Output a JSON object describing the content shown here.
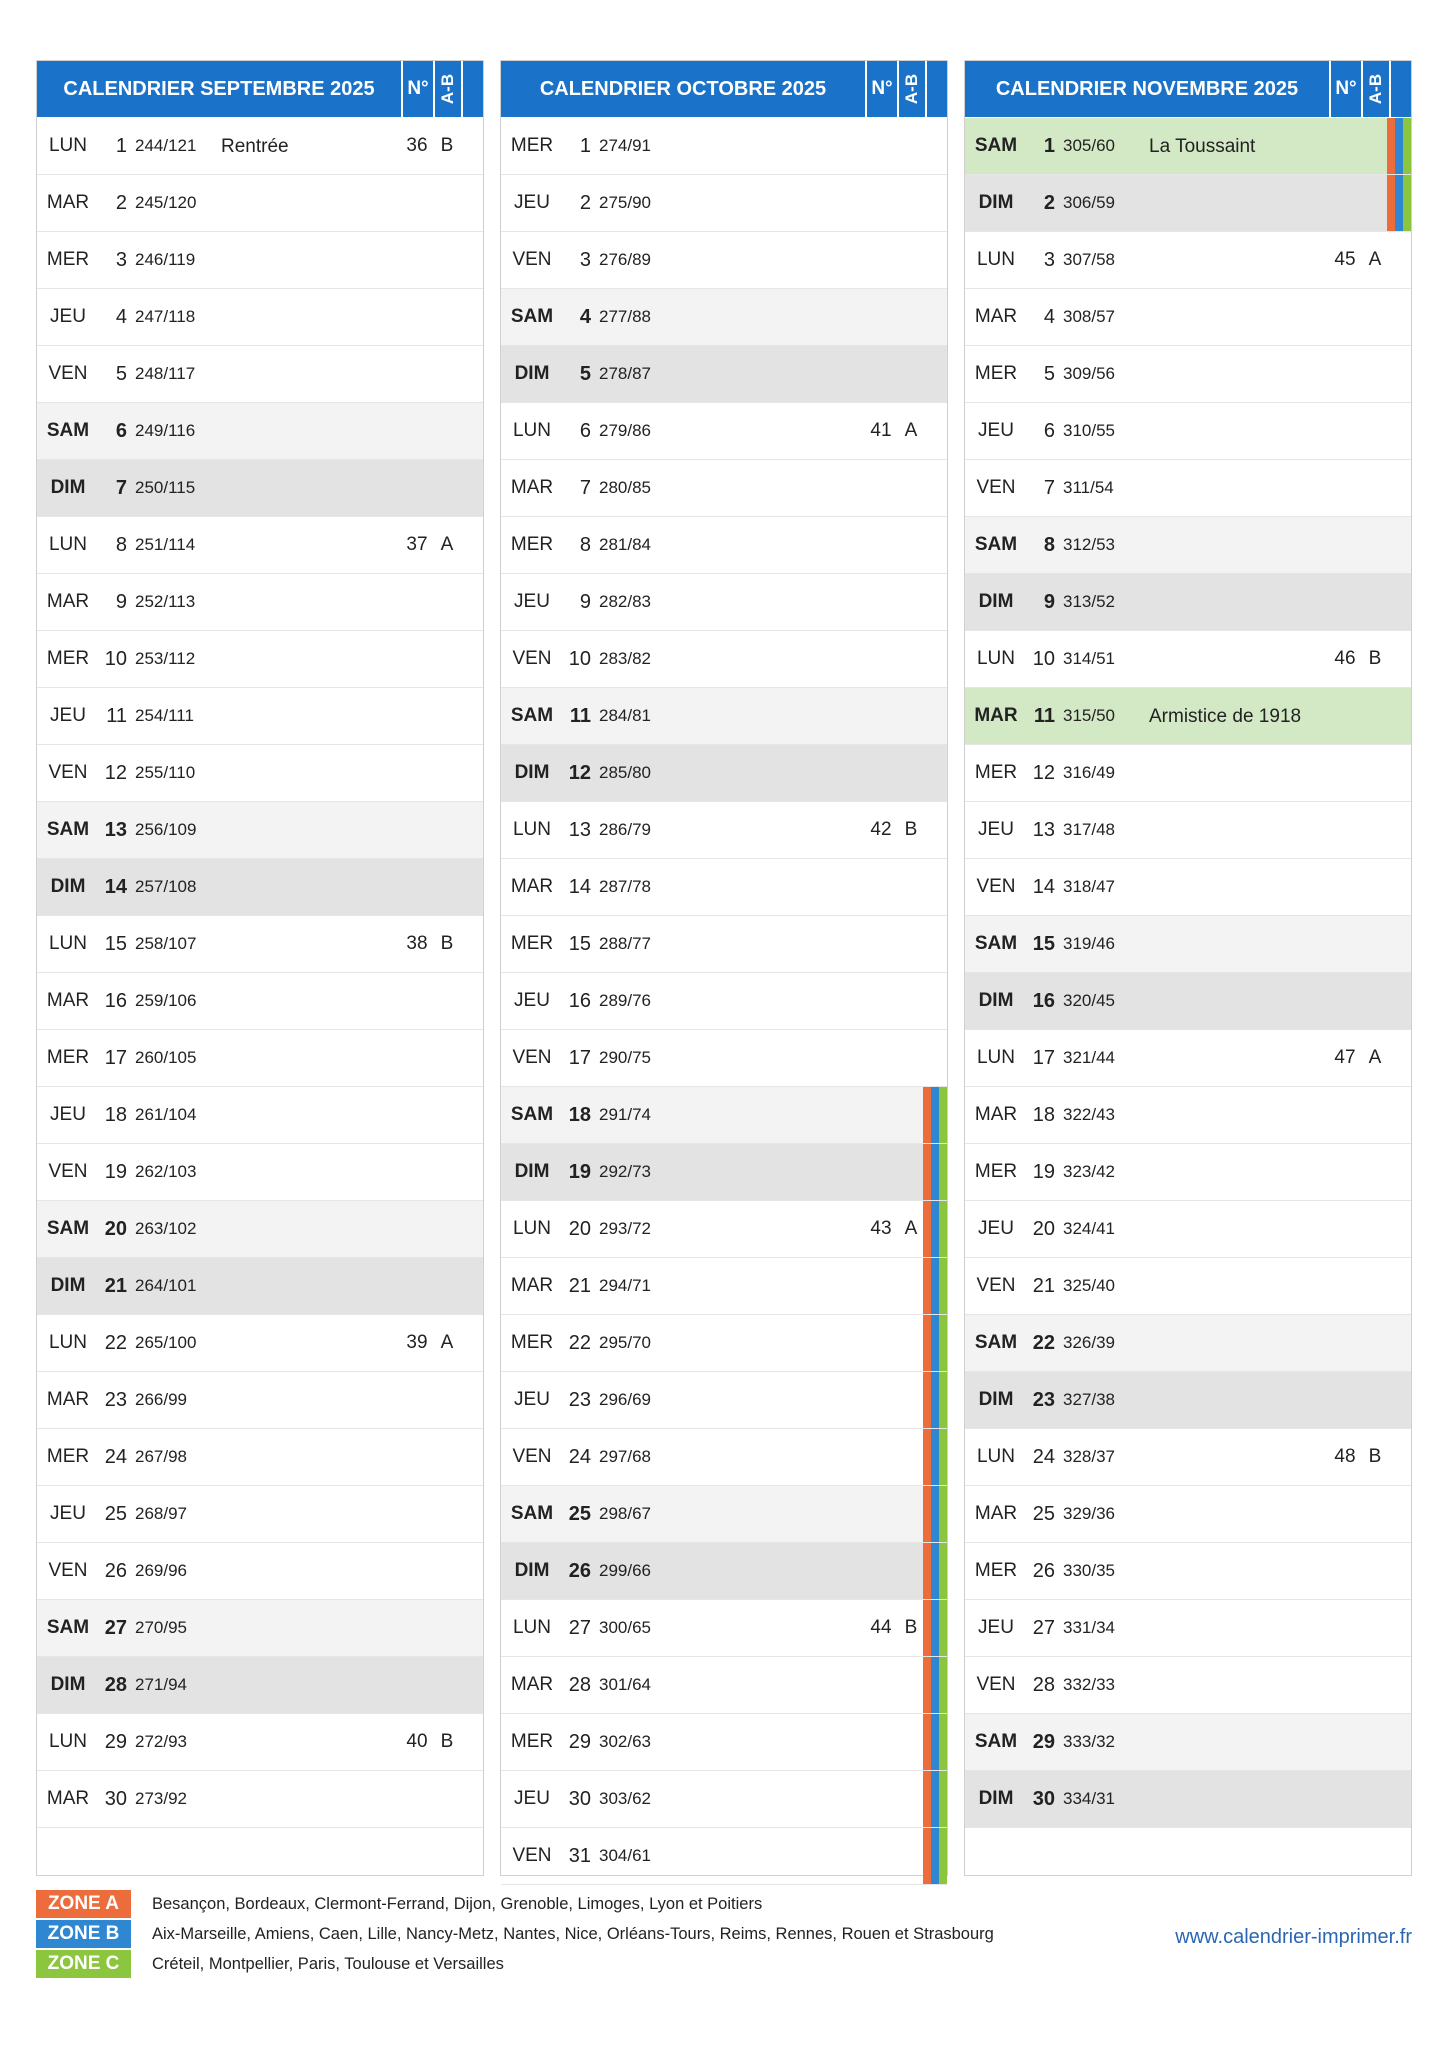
{
  "colors": {
    "header": "#1a73c9",
    "zone_a": "#ec6c3c",
    "zone_b": "#2f87d2",
    "zone_c": "#8cc63f",
    "holiday": "#d3e8c4"
  },
  "header_labels": {
    "week_number": "N°",
    "week_ab": "A-B"
  },
  "months": [
    {
      "title": "CALENDRIER SEPTEMBRE 2025",
      "days": [
        {
          "name": "LUN",
          "num": "1",
          "count": "244/121",
          "event": "Rentrée",
          "week": "36",
          "ab": "B"
        },
        {
          "name": "MAR",
          "num": "2",
          "count": "245/120"
        },
        {
          "name": "MER",
          "num": "3",
          "count": "246/119"
        },
        {
          "name": "JEU",
          "num": "4",
          "count": "247/118"
        },
        {
          "name": "VEN",
          "num": "5",
          "count": "248/117"
        },
        {
          "name": "SAM",
          "num": "6",
          "count": "249/116"
        },
        {
          "name": "DIM",
          "num": "7",
          "count": "250/115"
        },
        {
          "name": "LUN",
          "num": "8",
          "count": "251/114",
          "week": "37",
          "ab": "A"
        },
        {
          "name": "MAR",
          "num": "9",
          "count": "252/113"
        },
        {
          "name": "MER",
          "num": "10",
          "count": "253/112"
        },
        {
          "name": "JEU",
          "num": "11",
          "count": "254/111"
        },
        {
          "name": "VEN",
          "num": "12",
          "count": "255/110"
        },
        {
          "name": "SAM",
          "num": "13",
          "count": "256/109"
        },
        {
          "name": "DIM",
          "num": "14",
          "count": "257/108"
        },
        {
          "name": "LUN",
          "num": "15",
          "count": "258/107",
          "week": "38",
          "ab": "B"
        },
        {
          "name": "MAR",
          "num": "16",
          "count": "259/106"
        },
        {
          "name": "MER",
          "num": "17",
          "count": "260/105"
        },
        {
          "name": "JEU",
          "num": "18",
          "count": "261/104"
        },
        {
          "name": "VEN",
          "num": "19",
          "count": "262/103"
        },
        {
          "name": "SAM",
          "num": "20",
          "count": "263/102"
        },
        {
          "name": "DIM",
          "num": "21",
          "count": "264/101"
        },
        {
          "name": "LUN",
          "num": "22",
          "count": "265/100",
          "week": "39",
          "ab": "A"
        },
        {
          "name": "MAR",
          "num": "23",
          "count": "266/99"
        },
        {
          "name": "MER",
          "num": "24",
          "count": "267/98"
        },
        {
          "name": "JEU",
          "num": "25",
          "count": "268/97"
        },
        {
          "name": "VEN",
          "num": "26",
          "count": "269/96"
        },
        {
          "name": "SAM",
          "num": "27",
          "count": "270/95"
        },
        {
          "name": "DIM",
          "num": "28",
          "count": "271/94"
        },
        {
          "name": "LUN",
          "num": "29",
          "count": "272/93",
          "week": "40",
          "ab": "B"
        },
        {
          "name": "MAR",
          "num": "30",
          "count": "273/92"
        }
      ]
    },
    {
      "title": "CALENDRIER OCTOBRE 2025",
      "days": [
        {
          "name": "MER",
          "num": "1",
          "count": "274/91"
        },
        {
          "name": "JEU",
          "num": "2",
          "count": "275/90"
        },
        {
          "name": "VEN",
          "num": "3",
          "count": "276/89"
        },
        {
          "name": "SAM",
          "num": "4",
          "count": "277/88"
        },
        {
          "name": "DIM",
          "num": "5",
          "count": "278/87"
        },
        {
          "name": "LUN",
          "num": "6",
          "count": "279/86",
          "week": "41",
          "ab": "A"
        },
        {
          "name": "MAR",
          "num": "7",
          "count": "280/85"
        },
        {
          "name": "MER",
          "num": "8",
          "count": "281/84"
        },
        {
          "name": "JEU",
          "num": "9",
          "count": "282/83"
        },
        {
          "name": "VEN",
          "num": "10",
          "count": "283/82"
        },
        {
          "name": "SAM",
          "num": "11",
          "count": "284/81"
        },
        {
          "name": "DIM",
          "num": "12",
          "count": "285/80"
        },
        {
          "name": "LUN",
          "num": "13",
          "count": "286/79",
          "week": "42",
          "ab": "B"
        },
        {
          "name": "MAR",
          "num": "14",
          "count": "287/78"
        },
        {
          "name": "MER",
          "num": "15",
          "count": "288/77"
        },
        {
          "name": "JEU",
          "num": "16",
          "count": "289/76"
        },
        {
          "name": "VEN",
          "num": "17",
          "count": "290/75"
        },
        {
          "name": "SAM",
          "num": "18",
          "count": "291/74",
          "zones": "ABC"
        },
        {
          "name": "DIM",
          "num": "19",
          "count": "292/73",
          "zones": "ABC"
        },
        {
          "name": "LUN",
          "num": "20",
          "count": "293/72",
          "week": "43",
          "ab": "A",
          "zones": "ABC"
        },
        {
          "name": "MAR",
          "num": "21",
          "count": "294/71",
          "zones": "ABC"
        },
        {
          "name": "MER",
          "num": "22",
          "count": "295/70",
          "zones": "ABC"
        },
        {
          "name": "JEU",
          "num": "23",
          "count": "296/69",
          "zones": "ABC"
        },
        {
          "name": "VEN",
          "num": "24",
          "count": "297/68",
          "zones": "ABC"
        },
        {
          "name": "SAM",
          "num": "25",
          "count": "298/67",
          "zones": "ABC"
        },
        {
          "name": "DIM",
          "num": "26",
          "count": "299/66",
          "zones": "ABC"
        },
        {
          "name": "LUN",
          "num": "27",
          "count": "300/65",
          "week": "44",
          "ab": "B",
          "zones": "ABC"
        },
        {
          "name": "MAR",
          "num": "28",
          "count": "301/64",
          "zones": "ABC"
        },
        {
          "name": "MER",
          "num": "29",
          "count": "302/63",
          "zones": "ABC"
        },
        {
          "name": "JEU",
          "num": "30",
          "count": "303/62",
          "zones": "ABC"
        },
        {
          "name": "VEN",
          "num": "31",
          "count": "304/61",
          "zones": "ABC"
        }
      ]
    },
    {
      "title": "CALENDRIER NOVEMBRE 2025",
      "days": [
        {
          "name": "SAM",
          "num": "1",
          "count": "305/60",
          "event": "La Toussaint",
          "holiday": true,
          "zones": "ABC"
        },
        {
          "name": "DIM",
          "num": "2",
          "count": "306/59",
          "zones": "ABC"
        },
        {
          "name": "LUN",
          "num": "3",
          "count": "307/58",
          "week": "45",
          "ab": "A"
        },
        {
          "name": "MAR",
          "num": "4",
          "count": "308/57"
        },
        {
          "name": "MER",
          "num": "5",
          "count": "309/56"
        },
        {
          "name": "JEU",
          "num": "6",
          "count": "310/55"
        },
        {
          "name": "VEN",
          "num": "7",
          "count": "311/54"
        },
        {
          "name": "SAM",
          "num": "8",
          "count": "312/53"
        },
        {
          "name": "DIM",
          "num": "9",
          "count": "313/52"
        },
        {
          "name": "LUN",
          "num": "10",
          "count": "314/51",
          "week": "46",
          "ab": "B"
        },
        {
          "name": "MAR",
          "num": "11",
          "count": "315/50",
          "event": "Armistice de 1918",
          "holiday": true
        },
        {
          "name": "MER",
          "num": "12",
          "count": "316/49"
        },
        {
          "name": "JEU",
          "num": "13",
          "count": "317/48"
        },
        {
          "name": "VEN",
          "num": "14",
          "count": "318/47"
        },
        {
          "name": "SAM",
          "num": "15",
          "count": "319/46"
        },
        {
          "name": "DIM",
          "num": "16",
          "count": "320/45"
        },
        {
          "name": "LUN",
          "num": "17",
          "count": "321/44",
          "week": "47",
          "ab": "A"
        },
        {
          "name": "MAR",
          "num": "18",
          "count": "322/43"
        },
        {
          "name": "MER",
          "num": "19",
          "count": "323/42"
        },
        {
          "name": "JEU",
          "num": "20",
          "count": "324/41"
        },
        {
          "name": "VEN",
          "num": "21",
          "count": "325/40"
        },
        {
          "name": "SAM",
          "num": "22",
          "count": "326/39"
        },
        {
          "name": "DIM",
          "num": "23",
          "count": "327/38"
        },
        {
          "name": "LUN",
          "num": "24",
          "count": "328/37",
          "week": "48",
          "ab": "B"
        },
        {
          "name": "MAR",
          "num": "25",
          "count": "329/36"
        },
        {
          "name": "MER",
          "num": "26",
          "count": "330/35"
        },
        {
          "name": "JEU",
          "num": "27",
          "count": "331/34"
        },
        {
          "name": "VEN",
          "num": "28",
          "count": "332/33"
        },
        {
          "name": "SAM",
          "num": "29",
          "count": "333/32"
        },
        {
          "name": "DIM",
          "num": "30",
          "count": "334/31"
        }
      ]
    }
  ],
  "legend": [
    {
      "label": "ZONE A",
      "color": "#ec6c3c",
      "text": "Besançon, Bordeaux, Clermont-Ferrand, Dijon, Grenoble, Limoges, Lyon et Poitiers"
    },
    {
      "label": "ZONE B",
      "color": "#2f87d2",
      "text": "Aix-Marseille, Amiens, Caen, Lille, Nancy-Metz, Nantes, Nice, Orléans-Tours, Reims, Rennes, Rouen et Strasbourg"
    },
    {
      "label": "ZONE C",
      "color": "#8cc63f",
      "text": "Créteil, Montpellier, Paris, Toulouse et Versailles"
    }
  ],
  "website": "www.calendrier-imprimer.fr"
}
